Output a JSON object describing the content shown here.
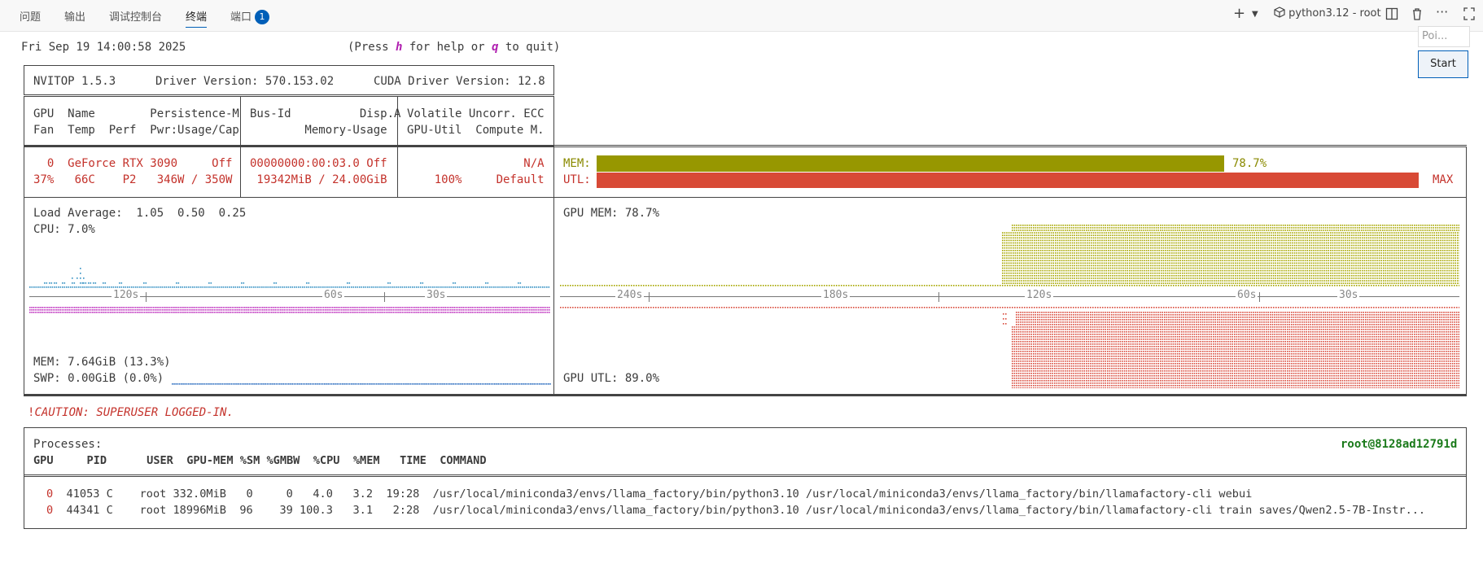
{
  "tabs": [
    {
      "label": "问题"
    },
    {
      "label": "输出"
    },
    {
      "label": "调试控制台"
    },
    {
      "label": "终端"
    },
    {
      "label": "端口",
      "badge": "1"
    }
  ],
  "toolbar": {
    "terminal_name": "python3.12 - root"
  },
  "popup": {
    "text": "Poi...",
    "start_label": "Start"
  },
  "terminal": {
    "timestamp": "Fri Sep 19 14:00:58 2025",
    "help_pre": "(Press ",
    "help_h": "h",
    "help_mid": " for help or ",
    "help_q": "q",
    "help_post": " to quit)",
    "nvitop_version": "NVITOP 1.5.3",
    "driver_version": "Driver Version: 570.153.02",
    "cuda_version": "CUDA Driver Version: 12.8",
    "hdr1_row1": "GPU  Name        Persistence-M",
    "hdr1_row2": "Fan  Temp  Perf  Pwr:Usage/Cap",
    "hdr2_row1": "Bus-Id          Disp.A",
    "hdr2_row2": "        Memory-Usage",
    "hdr3_row1": "Volatile Uncorr. ECC",
    "hdr3_row2": "GPU-Util  Compute M.",
    "gpu_row1": "  0  GeForce RTX 3090     Off",
    "gpu_row2": "37%   66C    P2   346W / 350W",
    "bus_row1": "00000000:00:03.0 Off",
    "bus_row2": " 19342MiB / 24.00GiB",
    "util_row1": "                 N/A",
    "util_row2": "    100%     Default",
    "mem_label": "MEM:",
    "mem_pct": "78.7%",
    "mem_fraction": 0.787,
    "utl_label": "UTL:",
    "utl_pct": "MAX",
    "utl_fraction": 1.0,
    "load_average": "Load Average:  1.05  0.50  0.25",
    "cpu": "CPU: 7.0%",
    "host_mem": "MEM: 7.64GiB (13.3%)",
    "swp": "SWP: 0.00GiB (0.0%)",
    "gpu_mem_graph": "GPU MEM: 78.7%",
    "gpu_utl_graph": "GPU UTL: 89.0%",
    "left_axis_labels": [
      "120s",
      "60s",
      "30s"
    ],
    "right_axis_labels": [
      "240s",
      "180s",
      "120s",
      "60s",
      "30s"
    ],
    "caution_mark": "!",
    "caution": "CAUTION: SUPERUSER LOGGED-IN.",
    "processes_title": "Processes:",
    "user_host": "root@8128ad12791d",
    "proc_header": "GPU     PID      USER  GPU-MEM %SM %GMBW  %CPU  %MEM   TIME  COMMAND",
    "processes": [
      {
        "gpu": "0",
        "rest": "  41053 C    root 332.0MiB   0     0   4.0   3.2  19:28  /usr/local/miniconda3/envs/llama_factory/bin/python3.10 /usr/local/miniconda3/envs/llama_factory/bin/llamafactory-cli webui"
      },
      {
        "gpu": "0",
        "rest": "  44341 C    root 18996MiB  96    39 100.3   3.1   2:28  /usr/local/miniconda3/envs/llama_factory/bin/python3.10 /usr/local/miniconda3/envs/llama_factory/bin/llamafactory-cli train saves/Qwen2.5-7B-Instr..."
      }
    ]
  },
  "colors": {
    "mem_bar": "#979700",
    "utl_bar": "#d84a36",
    "cpu_dots": "#2f8ec1",
    "mag_dots": "#c23cc2",
    "olive_dots": "#a7a700",
    "red_dots": "#d94b3d",
    "blue_dots": "#2e6fc0"
  }
}
